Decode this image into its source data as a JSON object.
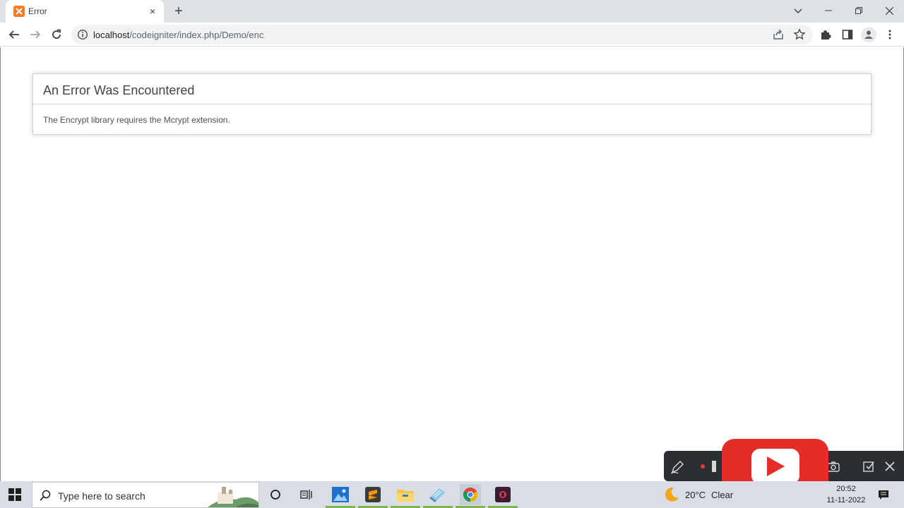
{
  "browser": {
    "tab_title": "Error",
    "tab_close": "×",
    "new_tab": "+",
    "url_host": "localhost",
    "url_path": "/codeigniter/index.php/Demo/enc"
  },
  "page": {
    "heading": "An Error Was Encountered",
    "message": "The Encrypt library requires the Mcrypt extension."
  },
  "taskbar": {
    "search_placeholder": "Type here to search",
    "weather_temp": "20°C",
    "weather_desc": "Clear",
    "time": "20:52",
    "date": "11-11-2022"
  },
  "colors": {
    "xampp_orange": "#fb7a24",
    "youtube_red": "#e52d27",
    "app_underline": "#7fb54b"
  },
  "icons": [
    "xampp-icon",
    "back-arrow-icon",
    "forward-arrow-icon",
    "reload-icon",
    "info-icon",
    "share-icon",
    "star-icon",
    "extensions-icon",
    "side-panel-icon",
    "profile-icon",
    "menu-kebab-icon",
    "windows-start-icon",
    "search-icon",
    "cortana-icon",
    "task-view-icon",
    "photos-icon",
    "sublime-text-icon",
    "file-explorer-icon",
    "notepad-icon",
    "chrome-icon",
    "recorder-app-icon",
    "moon-icon",
    "youtube-play-icon"
  ]
}
